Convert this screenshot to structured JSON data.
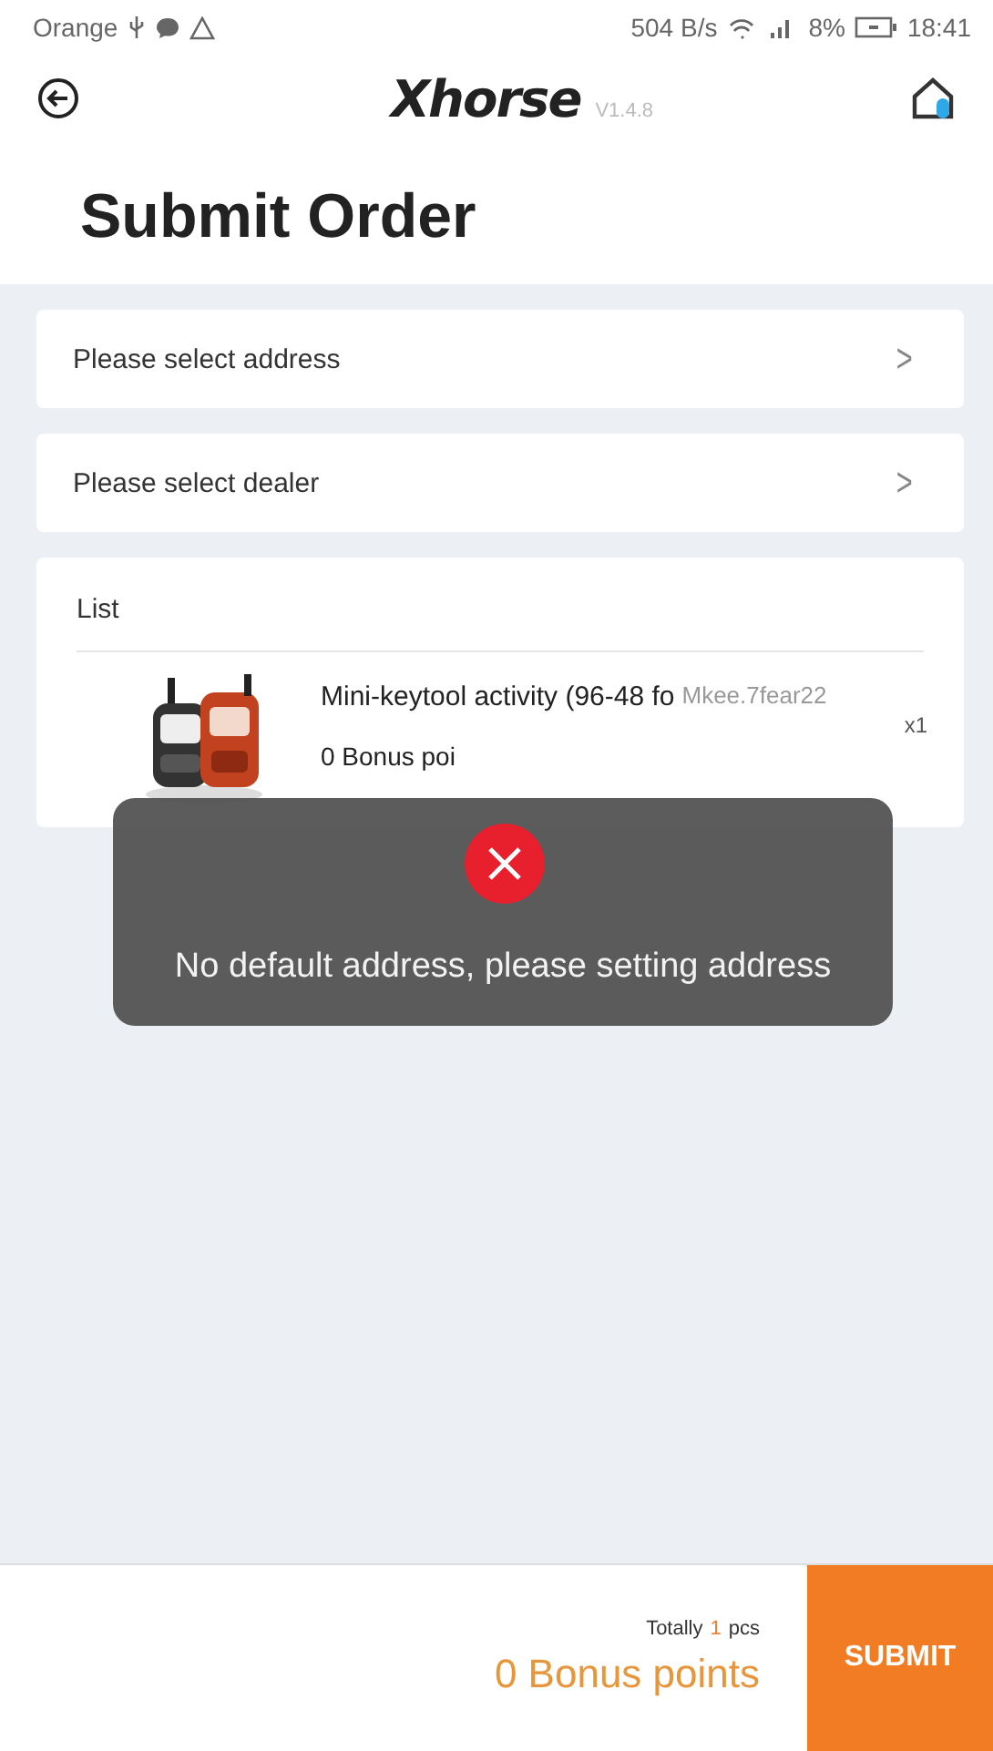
{
  "status_bar": {
    "carrier": "Orange",
    "speed": "504 B/s",
    "battery": "8%",
    "time": "18:41"
  },
  "header": {
    "logo": "Xhorse",
    "version": "V1.4.8"
  },
  "title": "Submit Order",
  "selectors": [
    {
      "label": "Please select address",
      "chevron": ">"
    },
    {
      "label": "Please select dealer",
      "chevron": ">"
    }
  ],
  "list": {
    "heading": "List",
    "items": [
      {
        "kind": "picture",
        "name": "Mini-keytool activity (96-48 fo",
        "code": "Mkee.7fear22",
        "quantity": "x1",
        "points": "0 Bonus poi"
      }
    ]
  },
  "toast": {
    "message": "No default address, please setting address"
  },
  "footer": {
    "total_prefix": "Totally",
    "total_count": "1",
    "total_suffix": "pcs",
    "points": "0 Bonus points",
    "submit": "SUBMIT"
  }
}
